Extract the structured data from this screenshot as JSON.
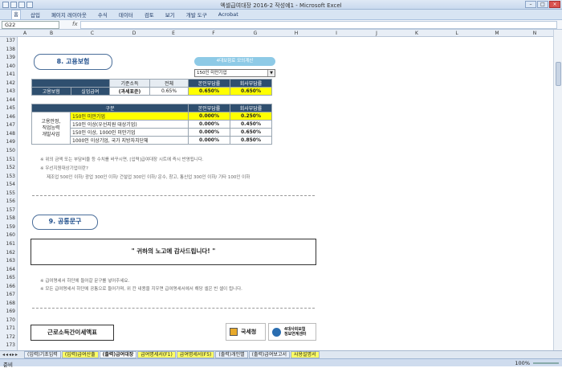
{
  "window": {
    "title": "엑셀급여대장 2016-2 작성예1 - Microsoft Excel"
  },
  "ribbon": {
    "tabs": [
      "홈",
      "삽입",
      "페이지 레이아웃",
      "수식",
      "데이터",
      "검토",
      "보기",
      "개발 도구",
      "Acrobat"
    ]
  },
  "formula_bar": {
    "name_box": "G22",
    "fx": "fx",
    "value": ""
  },
  "columns": [
    "A",
    "B",
    "C",
    "D",
    "E",
    "F",
    "G",
    "H",
    "I",
    "J",
    "K",
    "L",
    "M",
    "N"
  ],
  "rows": [
    "137",
    "138",
    "139",
    "140",
    "141",
    "142",
    "143",
    "144",
    "145",
    "146",
    "147",
    "148",
    "149",
    "150",
    "151",
    "152",
    "153",
    "154",
    "155",
    "156",
    "157",
    "158",
    "159",
    "160",
    "161",
    "162",
    "163",
    "164",
    "165",
    "166",
    "167",
    "168",
    "169",
    "170",
    "171",
    "172",
    "173"
  ],
  "section8": {
    "title": "8. 고용보험",
    "calc_button": "4대보험료 모의계산",
    "dropdown_value": "150인 미만기업",
    "table1": {
      "headers": [
        "기준소득",
        "전체",
        "본인부담률",
        "회사부담률"
      ],
      "row": [
        "고용보험",
        "실업급여",
        "(과세표준)",
        "0.65%",
        "0.650%",
        "0.650%"
      ]
    },
    "table2": {
      "headers": [
        "구분",
        "본인부담률",
        "회사부담률"
      ],
      "group_label": "고용안정,\n직업능력\n개발사업",
      "rows": [
        [
          "150인 미만기업",
          "0.000%",
          "0.250%"
        ],
        [
          "150인 이상(우선지원 대상기업)",
          "0.000%",
          "0.450%"
        ],
        [
          "150인 이상, 1000인 미만기업",
          "0.000%",
          "0.650%"
        ],
        [
          "1000인 이상기업, 국가 지방자치단체",
          "0.000%",
          "0.850%"
        ]
      ]
    },
    "notes": [
      "※ 위의 금액 또는 부담비율 등 수치를 바꾸시면, [입력]급여대장 시트에 즉시 반영됩니다.",
      "※ 우선지원대상기업이란?",
      "제조업 500인 이하/ 광업 300인 이하/ 건설업 300인 이하/ 운수, 창고, 통신업 300인 이하/ 기타 100인 이하"
    ]
  },
  "section9": {
    "title": "9. 공통문구",
    "message": "\" 귀하의 노고에 감사드립니다! \"",
    "notes": [
      "※ 급여명세서 하단에 들어갈 문구를 넣어주세요.",
      "※ 모든 급여명세서 하단에 공통으로 들어가며, 위 칸 내용을 지우면 급여명세서에서 해당 셀은 빈 셀이 됩니다."
    ]
  },
  "footer": {
    "tax_button": "근로소득간이세액표",
    "logo1": "국세청",
    "logo2_line1": "4대사회보험",
    "logo2_line2": "정보연계센터"
  },
  "sheet_tabs": [
    "(입력)기초입력",
    "(입력)급여산출",
    "(출력)급여대장",
    "급여명세서(F1)",
    "급여명세서(F5)",
    "(출력)개인별",
    "(출력)급여보고서",
    "사용설명서"
  ],
  "status": {
    "ready": "준비",
    "zoom": "100%"
  }
}
